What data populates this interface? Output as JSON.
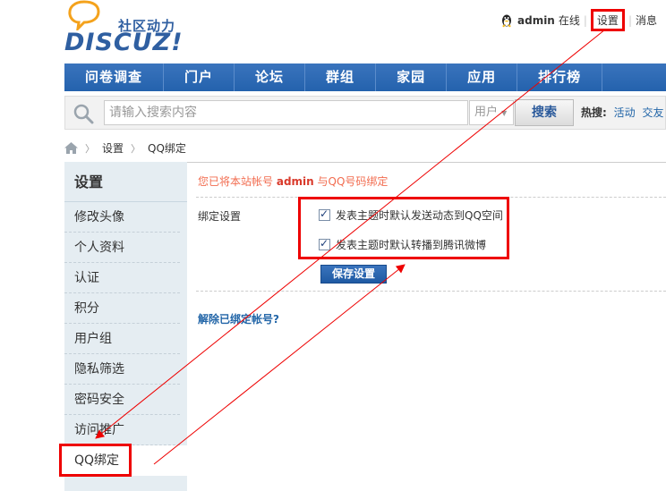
{
  "logo": {
    "brand": "DISCUZ!",
    "slogan": "社区动力"
  },
  "userbar": {
    "username": "admin",
    "status": "在线",
    "settings": "设置",
    "messages": "消息"
  },
  "nav": {
    "items": [
      "问卷调查",
      "门户",
      "论坛",
      "群组",
      "家园",
      "应用",
      "排行榜"
    ]
  },
  "search": {
    "placeholder": "请输入搜索内容",
    "type": "用户",
    "button": "搜索",
    "hot_label": "热搜:",
    "hot_items": [
      "活动",
      "交友"
    ]
  },
  "breadcrumb": {
    "items": [
      "设置",
      "QQ绑定"
    ]
  },
  "sidebar": {
    "title": "设置",
    "items": [
      "修改头像",
      "个人资料",
      "认证",
      "积分",
      "用户组",
      "隐私筛选",
      "密码安全",
      "访问推广",
      "QQ绑定"
    ]
  },
  "main": {
    "notice_prefix": "您已将本站帐号",
    "notice_user": "admin",
    "notice_suffix": "与QQ号码绑定",
    "bind_label": "绑定设置",
    "option1": "发表主题时默认发送动态到QQ空间",
    "option2": "发表主题时默认转播到腾讯微博",
    "save_button": "保存设置",
    "unbind_link": "解除已绑定帐号?"
  },
  "colors": {
    "nav": "#2462ad",
    "annotation": "#e00000",
    "notice": "#f26c4f"
  }
}
